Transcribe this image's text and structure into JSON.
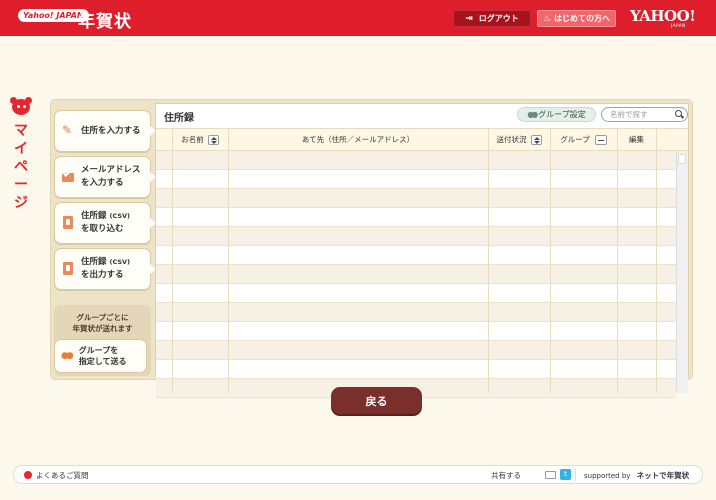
{
  "header": {
    "logo_badge": "Yahoo! JAPAN",
    "logo_text": "年賀状",
    "logout_label": "ログアウト",
    "first_time_label": "はじめての方へ",
    "yahoo_logo": "YAHOO!",
    "yahoo_sub": "JAPAN",
    "background_color": "#de1f2b"
  },
  "mypage": {
    "label": "マイページ"
  },
  "sidebar": {
    "items": [
      {
        "line1": "住所を入力する",
        "line2": "",
        "icon": "pen-icon"
      },
      {
        "line1": "メールアドレス",
        "line2": "を入力する",
        "icon": "mail-icon"
      },
      {
        "line1": "住所録",
        "line1_small": "(CSV)",
        "line2": "を取り込む",
        "icon": "document-icon"
      },
      {
        "line1": "住所録",
        "line1_small": "(CSV)",
        "line2": "を出力する",
        "icon": "document-icon"
      }
    ],
    "group_note_line1": "グループごとに",
    "group_note_line2": "年賀状が送れます",
    "group_button_line1": "グループを",
    "group_button_line2": "指定して送る"
  },
  "address_book": {
    "title": "住所録",
    "group_settings_label": "グループ設定",
    "search_placeholder": "名前で探す",
    "columns": {
      "name": "お名前",
      "destination": "あて先（住所／メールアドレス）",
      "status": "送付状況",
      "group": "グループ",
      "edit": "編集"
    },
    "rows": []
  },
  "back_label": "戻る",
  "footer": {
    "faq": "よくあるご質問",
    "share": "共有する",
    "supported_by": "supported by",
    "supported_brand": "ネットで年賀状"
  }
}
